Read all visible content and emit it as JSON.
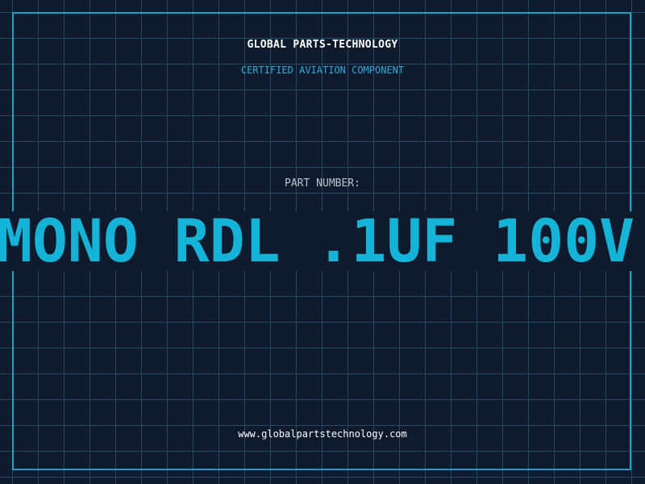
{
  "header": {
    "brand": "GLOBAL PARTS-TECHNOLOGY",
    "subtitle": "CERTIFIED AVIATION COMPONENT"
  },
  "main": {
    "part_label": "PART NUMBER:",
    "part_number": "MONO RDL .1UF 100V"
  },
  "footer": {
    "url": "www.globalpartstechnology.com"
  },
  "colors": {
    "background": "#0f1a2c",
    "grid": "#1e4a63",
    "frame": "#1fa0c8",
    "accent": "#14b4d8",
    "subtitle": "#2aaee0"
  }
}
